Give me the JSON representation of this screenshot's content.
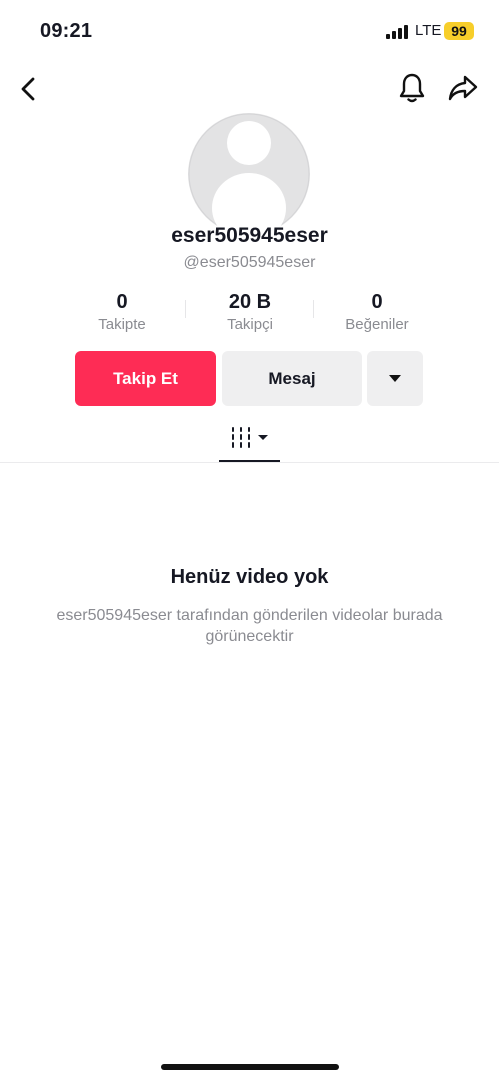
{
  "status_bar": {
    "time": "09:21",
    "network": "LTE",
    "battery": "99",
    "battery_color": "#f7ce2a"
  },
  "nav": {
    "back_icon": "chevron-left-icon",
    "bell_icon": "bell-icon",
    "share_icon": "share-arrow-icon"
  },
  "profile": {
    "display_name": "eser505945eser",
    "username": "@eser505945eser",
    "avatar_icon": "default-avatar-icon"
  },
  "stats": [
    {
      "value": "0",
      "label": "Takipte"
    },
    {
      "value": "20 B",
      "label": "Takipçi"
    },
    {
      "value": "0",
      "label": "Beğeniler"
    }
  ],
  "actions": {
    "follow_label": "Takip Et",
    "message_label": "Mesaj",
    "more_icon": "caret-down-icon",
    "accent_color": "#fe2c55"
  },
  "tabs": {
    "active_icon": "videos-grid-icon"
  },
  "empty_state": {
    "title": "Henüz video yok",
    "description": "eser505945eser tarafından gönderilen videolar burada görünecektir"
  }
}
